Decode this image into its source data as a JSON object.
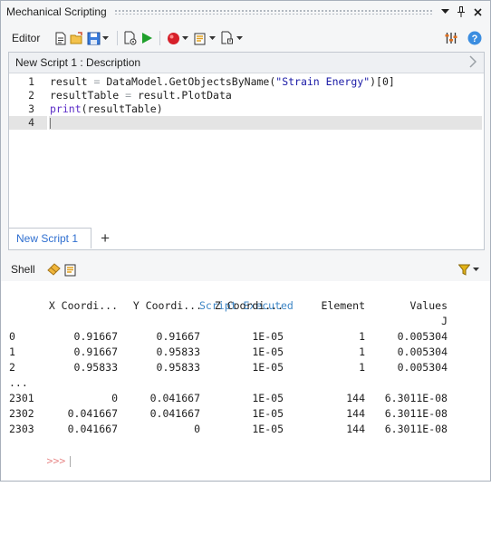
{
  "window": {
    "title": "Mechanical Scripting",
    "controls": [
      "▾",
      "ᚹ",
      "✕"
    ]
  },
  "toolbar": {
    "label": "Editor"
  },
  "editor": {
    "description": "New Script 1  : Description",
    "line_numbers": [
      "1",
      "2",
      "3",
      "4"
    ],
    "code": [
      {
        "a": "result",
        "b": " = ",
        "c": "DataModel.GetObjectsByName(",
        "d": "\"Strain Energy\"",
        "e": ")[0]"
      },
      {
        "a": "resultTable",
        "b": " = ",
        "c": "result.PlotData",
        "d": "",
        "e": ""
      },
      {
        "a": "print",
        "b": "",
        "c": "(resultTable)",
        "d": "",
        "e": ""
      }
    ],
    "tab_label": "New Script 1",
    "add_tab": "+"
  },
  "shell": {
    "label": "Shell",
    "executed": "Script Executed",
    "headers": [
      "X Coordi...",
      "Y Coordi...",
      "Z Coordi...",
      "Element",
      "Values"
    ],
    "unit": "J",
    "rows": [
      [
        "0",
        "0.91667",
        "0.91667",
        "1E-05",
        "1",
        "0.005304"
      ],
      [
        "1",
        "0.91667",
        "0.95833",
        "1E-05",
        "1",
        "0.005304"
      ],
      [
        "2",
        "0.95833",
        "0.95833",
        "1E-05",
        "1",
        "0.005304"
      ],
      [
        "...",
        "",
        "",
        "",
        "",
        ""
      ],
      [
        "2301",
        "0",
        "0.041667",
        "1E-05",
        "144",
        "6.3011E-08"
      ],
      [
        "2302",
        "0.041667",
        "0.041667",
        "1E-05",
        "144",
        "6.3011E-08"
      ],
      [
        "2303",
        "0.041667",
        "0",
        "1E-05",
        "144",
        "6.3011E-08"
      ]
    ],
    "prompt": ">>>"
  }
}
